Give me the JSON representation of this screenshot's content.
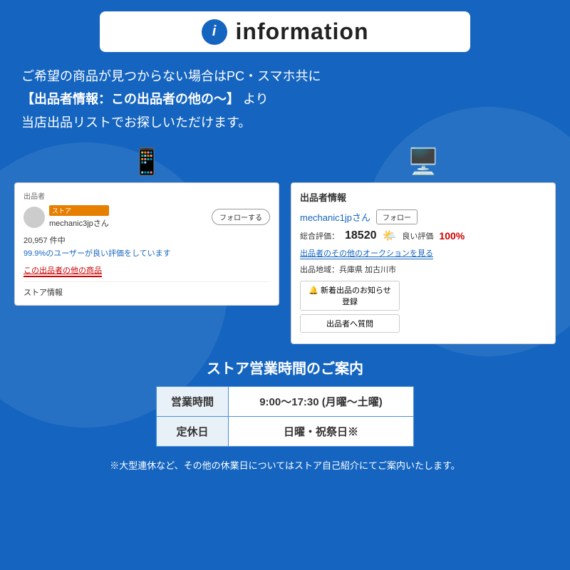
{
  "header": {
    "icon_text": "i",
    "title": "information"
  },
  "intro": {
    "line1": "ご希望の商品が見つからない場合はPC・スマホ共に",
    "line2_bold": "【出品者情報：この出品者の他の〜】",
    "line2_rest": " より",
    "line3": "当店出品リストでお探しいただけます。"
  },
  "mobile_card": {
    "section_label": "出品者",
    "store_badge": "ストア",
    "seller_name": "mechanic3jpさん",
    "follow_btn": "フォローする",
    "stats": "20,957 件中",
    "good_rate": "99.9%のユーザーが良い評価をしています",
    "other_link": "この出品者の他の商品",
    "store_info": "ストア情報"
  },
  "pc_card": {
    "section_title": "出品者情報",
    "seller_name": "mechanic1jpさん",
    "follow_btn": "フォロー",
    "rating_label": "総合評価：",
    "rating_num": "18520",
    "good_label": "良い評価",
    "good_pct": "100%",
    "auction_link": "出品者のその他のオークションを見る",
    "location_label": "出品地域：兵庫県 加古川市",
    "notif_btn": "🔔 新着出品のお知らせ登録",
    "question_btn": "出品者へ質問"
  },
  "store_hours": {
    "title": "ストア営業時間のご案内",
    "rows": [
      {
        "label": "営業時間",
        "value": "9:00〜17:30 (月曜〜土曜)"
      },
      {
        "label": "定休日",
        "value": "日曜・祝祭日※"
      }
    ]
  },
  "footer_note": "※大型連休など、その他の休業日についてはストア自己紹介にてご案内いたします。",
  "icons": {
    "mobile": "📱",
    "pc": "💻",
    "sun": "🌤️"
  }
}
